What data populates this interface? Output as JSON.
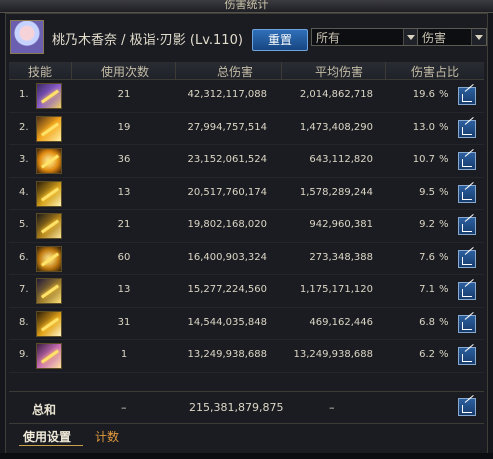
{
  "window": {
    "title": "伤害统计"
  },
  "header": {
    "character_name": "桃乃木香奈 / 极诣·刃影 (Lv.110)",
    "reset_label": "重置",
    "target_filter": "所有",
    "metric_filter": "伤害"
  },
  "columns": {
    "skill": "技能",
    "uses": "使用次数",
    "total": "总伤害",
    "avg": "平均伤害",
    "share": "伤害占比"
  },
  "rows": [
    {
      "rank": "1.",
      "uses": "21",
      "total": "42,312,117,088",
      "avg": "2,014,862,718",
      "pct": "19.6",
      "pct_symbol": "%"
    },
    {
      "rank": "2.",
      "uses": "19",
      "total": "27,994,757,514",
      "avg": "1,473,408,290",
      "pct": "13.0",
      "pct_symbol": "%"
    },
    {
      "rank": "3.",
      "uses": "36",
      "total": "23,152,061,524",
      "avg": "643,112,820",
      "pct": "10.7",
      "pct_symbol": "%"
    },
    {
      "rank": "4.",
      "uses": "13",
      "total": "20,517,760,174",
      "avg": "1,578,289,244",
      "pct": "9.5",
      "pct_symbol": "%"
    },
    {
      "rank": "5.",
      "uses": "21",
      "total": "19,802,168,020",
      "avg": "942,960,381",
      "pct": "9.2",
      "pct_symbol": "%"
    },
    {
      "rank": "6.",
      "uses": "60",
      "total": "16,400,903,324",
      "avg": "273,348,388",
      "pct": "7.6",
      "pct_symbol": "%"
    },
    {
      "rank": "7.",
      "uses": "13",
      "total": "15,277,224,560",
      "avg": "1,175,171,120",
      "pct": "7.1",
      "pct_symbol": "%"
    },
    {
      "rank": "8.",
      "uses": "31",
      "total": "14,544,035,848",
      "avg": "469,162,446",
      "pct": "6.8",
      "pct_symbol": "%"
    },
    {
      "rank": "9.",
      "uses": "1",
      "total": "13,249,938,688",
      "avg": "13,249,938,688",
      "pct": "6.2",
      "pct_symbol": "%"
    }
  ],
  "summary": {
    "label": "总和",
    "uses": "–",
    "total": "215,381,879,875",
    "avg": "–"
  },
  "footer": {
    "tab_settings": "使用设置",
    "tab_count": "计数"
  }
}
